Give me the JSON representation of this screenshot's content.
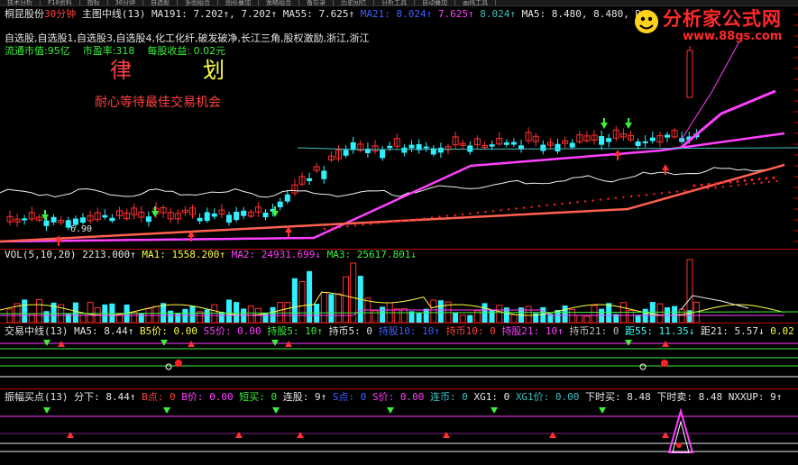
{
  "menu": [
    "技术分析",
    "F10资料",
    "指标",
    "30分钟",
    "自选股",
    "多图组合",
    "图形叠加",
    "策略组合",
    "备忘录",
    "历史回忆",
    "分析工具",
    "自动叠加",
    "画线工具"
  ],
  "stock": {
    "name": "桐昆股份",
    "period": "30分钟",
    "chart": "主图中线"
  },
  "main_legend": [
    {
      "text": "主图中线(13)",
      "color": "#e6e6e6"
    },
    {
      "text": "MA191: 7.202↑, 7.202↑",
      "color": "#e6e6e6"
    },
    {
      "text": "MA55: 7.625↑",
      "color": "#e6e6e6"
    },
    {
      "text": "MA21: 8.024↑",
      "color": "#4060ff"
    },
    {
      "text": "7.625↑",
      "color": "#ff40ff"
    },
    {
      "text": "8.024↑",
      "color": "#40c0c0"
    },
    {
      "text": "MA5: 8.480, 8.480, D",
      "color": "#e6e6e6"
    }
  ],
  "concepts": "自选股,自选股1,自选股3,自选股4,化工化纤,破发破净,长江三角,股权激励,浙江,浙江",
  "fund_line": {
    "mkt_cap": "流通市值:95亿",
    "pe": "市盈率:318",
    "eps": "每股收益: 0.02元"
  },
  "overlay": {
    "char1": "律",
    "char2": "划",
    "motto": "耐心等待最佳交易机会"
  },
  "price_label": "6.90",
  "vol_legend": [
    {
      "text": "VOL(5,10,20)",
      "color": "#e6e6e6"
    },
    {
      "text": "2213.000↑",
      "color": "#e6e6e6"
    },
    {
      "text": "MA1: 1558.200↑",
      "color": "#ffff40"
    },
    {
      "text": "MA2: 24931.699↓",
      "color": "#ff40ff"
    },
    {
      "text": "MA3: 25617.801↓",
      "color": "#3cf03c"
    }
  ],
  "pane3_legend": [
    {
      "text": "交易中线(13)",
      "color": "#e6e6e6"
    },
    {
      "text": "MA5: 8.44↑",
      "color": "#e6e6e6"
    },
    {
      "text": "B5价: 0.00",
      "color": "#ffff40"
    },
    {
      "text": "S5价: 0.00",
      "color": "#ff40ff"
    },
    {
      "text": "持股5: 10↑",
      "color": "#3cf03c"
    },
    {
      "text": "持币5: 0",
      "color": "#e6e6e6"
    },
    {
      "text": "持股10: 10↑",
      "color": "#4060ff"
    },
    {
      "text": "持币10: 0",
      "color": "#ff4040"
    },
    {
      "text": "持股21: 10↑",
      "color": "#ff40ff"
    },
    {
      "text": "持币21: 0",
      "color": "#c0c0c0"
    },
    {
      "text": "距55: 11.35↓",
      "color": "#40ffff"
    },
    {
      "text": "距21: 5.57↓",
      "color": "#e6e6e6"
    },
    {
      "text": "0.02",
      "color": "#ffff40"
    }
  ],
  "pane4_legend": [
    {
      "text": "振幅买点(13)",
      "color": "#e6e6e6"
    },
    {
      "text": "分下: 8.44↑",
      "color": "#e6e6e6"
    },
    {
      "text": "B点: 0",
      "color": "#ff4040"
    },
    {
      "text": "B价: 0.00",
      "color": "#ff40ff"
    },
    {
      "text": "短买: 0",
      "color": "#3cf03c"
    },
    {
      "text": "连股: 9↑",
      "color": "#e6e6e6"
    },
    {
      "text": "S点: 0",
      "color": "#4060ff"
    },
    {
      "text": "S价: 0.00",
      "color": "#ff40ff"
    },
    {
      "text": "连币: 0",
      "color": "#40c0c0"
    },
    {
      "text": "XG1: 0",
      "color": "#e6e6e6"
    },
    {
      "text": "XG1价: 0.00",
      "color": "#40c0c0"
    },
    {
      "text": "下时买: 8.48",
      "color": "#e6e6e6"
    },
    {
      "text": "下时卖: 8.48",
      "color": "#e6e6e6"
    },
    {
      "text": "NXXUP: 9↑",
      "color": "#e6e6e6"
    }
  ],
  "logo": {
    "title": "分析家公式网",
    "url": "www.88gs.com"
  },
  "colors": {
    "up": "#ff3030",
    "down": "#30f0ff",
    "bg": "#000000",
    "frame": "#b00000"
  }
}
